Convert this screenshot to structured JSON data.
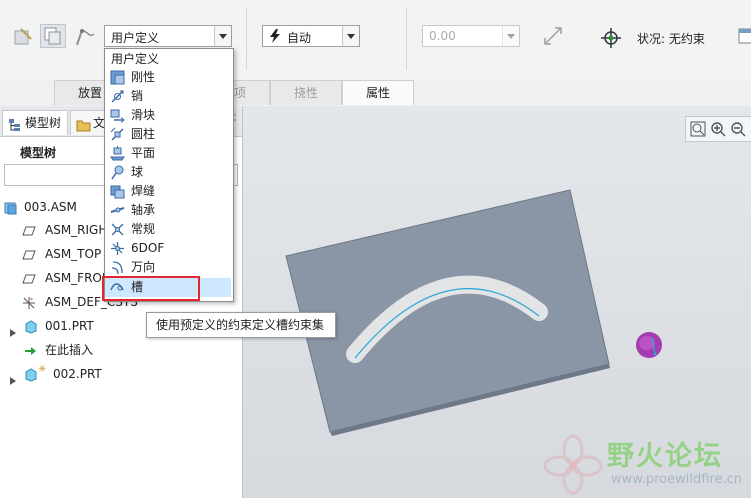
{
  "ribbon": {
    "constraint_type": "用户定义",
    "auto_mode": "自动",
    "offset_value": "0.00",
    "status_label": "状况: 无约束"
  },
  "tabs": [
    {
      "label": "放置"
    },
    {
      "label": "选项"
    },
    {
      "label": "挠性"
    },
    {
      "label": "属性"
    }
  ],
  "model_tree": {
    "tab_model": "模型树",
    "tab_file": "文",
    "header": "模型树",
    "items": [
      {
        "label": "003.ASM",
        "icon": "assembly-icon"
      },
      {
        "label": "ASM_RIGHT",
        "icon": "datum-plane-icon"
      },
      {
        "label": "ASM_TOP",
        "icon": "datum-plane-icon"
      },
      {
        "label": "ASM_FRONT",
        "icon": "datum-plane-icon"
      },
      {
        "label": "ASM_DEF_CSYS",
        "icon": "csys-icon"
      },
      {
        "label": "001.PRT",
        "icon": "part-icon"
      },
      {
        "label": "在此插入",
        "icon": "insert-arrow-icon"
      },
      {
        "label": "002.PRT",
        "icon": "part-icon"
      }
    ]
  },
  "dropdown": {
    "header": "用户定义",
    "items": [
      {
        "label": "刚性",
        "icon": "rigid-icon"
      },
      {
        "label": "销",
        "icon": "pin-icon"
      },
      {
        "label": "滑块",
        "icon": "slider-icon"
      },
      {
        "label": "圆柱",
        "icon": "cylinder-icon"
      },
      {
        "label": "平面",
        "icon": "planar-icon"
      },
      {
        "label": "球",
        "icon": "ball-icon"
      },
      {
        "label": "焊缝",
        "icon": "weld-icon"
      },
      {
        "label": "轴承",
        "icon": "bearing-icon"
      },
      {
        "label": "常规",
        "icon": "general-icon"
      },
      {
        "label": "6DOF",
        "icon": "6dof-icon"
      },
      {
        "label": "万向",
        "icon": "gimbal-icon"
      },
      {
        "label": "槽",
        "icon": "slot-icon"
      }
    ],
    "selected": "槽"
  },
  "tooltip": "使用预定义的约束定义槽约束集",
  "watermark": {
    "title": "野火论坛",
    "url": "www.proewildfire.cn"
  },
  "colors": {
    "plate": "#8a96a6",
    "slot": "#ececee",
    "slot_line": "#2aa7d8",
    "pin": "#a53bb2",
    "highlight": "#e2262b",
    "selected_row": "#cde8ff"
  }
}
